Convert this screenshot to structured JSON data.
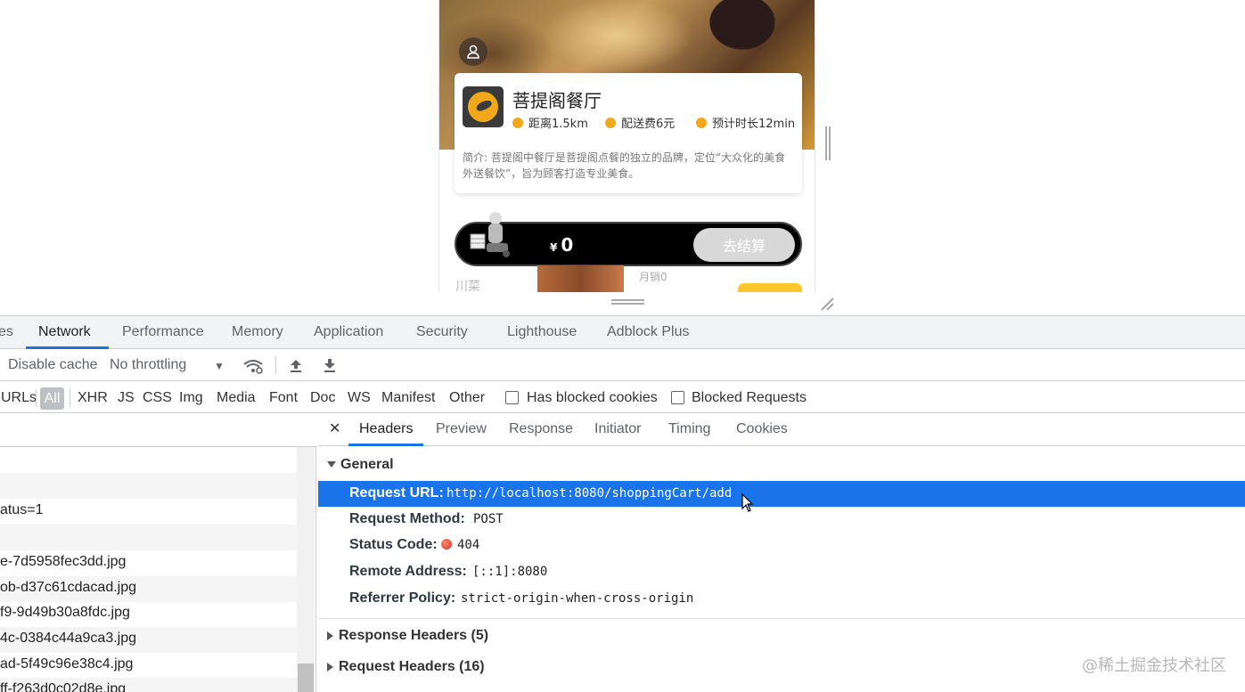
{
  "preview": {
    "store_name": "菩提阁餐厅",
    "distance": "距离1.5km",
    "delivery_fee": "配送费6元",
    "eta": "预计时长12min",
    "intro": "简介: 菩提阁中餐厅是菩提阁点餐的独立的品牌，定位“大众化的美食外送餐饮”，旨为顾客打造专业美食。",
    "cart_currency": "¥",
    "cart_total": "0",
    "checkout_label": "去结算",
    "category_label": "川菜",
    "sales_label": "月销0"
  },
  "devtools": {
    "main_tabs": [
      "es",
      "Network",
      "Performance",
      "Memory",
      "Application",
      "Security",
      "Lighthouse",
      "Adblock Plus"
    ],
    "active_tab": "Network",
    "toolbar": {
      "disable_cache": "Disable cache",
      "throttling": "No throttling"
    },
    "filter": {
      "urls_label": "URLs",
      "all": "All",
      "types": [
        "XHR",
        "JS",
        "CSS",
        "Img",
        "Media",
        "Font",
        "Doc",
        "WS",
        "Manifest",
        "Other"
      ],
      "blocked_cookies": "Has blocked cookies",
      "blocked_requests": "Blocked Requests"
    },
    "requests": [
      "atus=1",
      "e-7d5958fec3dd.jpg",
      "ob-d37c61cdacad.jpg",
      "f9-9d49b30a8fdc.jpg",
      "4c-0384c44a9ca3.jpg",
      "ad-5f49c96e38c4.jpg",
      "ff-f263d0c02d8e.jpg"
    ],
    "detail_tabs": [
      "Headers",
      "Preview",
      "Response",
      "Initiator",
      "Timing",
      "Cookies"
    ],
    "active_detail_tab": "Headers",
    "general": {
      "title": "General",
      "request_url_label": "Request URL:",
      "request_url": "http://localhost:8080/shoppingCart/add",
      "request_method_label": "Request Method:",
      "request_method": "POST",
      "status_code_label": "Status Code:",
      "status_code": "404",
      "remote_address_label": "Remote Address:",
      "remote_address": "[::1]:8080",
      "referrer_policy_label": "Referrer Policy:",
      "referrer_policy": "strict-origin-when-cross-origin"
    },
    "response_headers": "Response Headers (5)",
    "request_headers": "Request Headers (16)"
  },
  "watermark": "@稀土掘金技术社区",
  "colors": {
    "accent": "#1a73e8",
    "brand_yellow": "#f1a81b",
    "status_error": "#d93025"
  }
}
